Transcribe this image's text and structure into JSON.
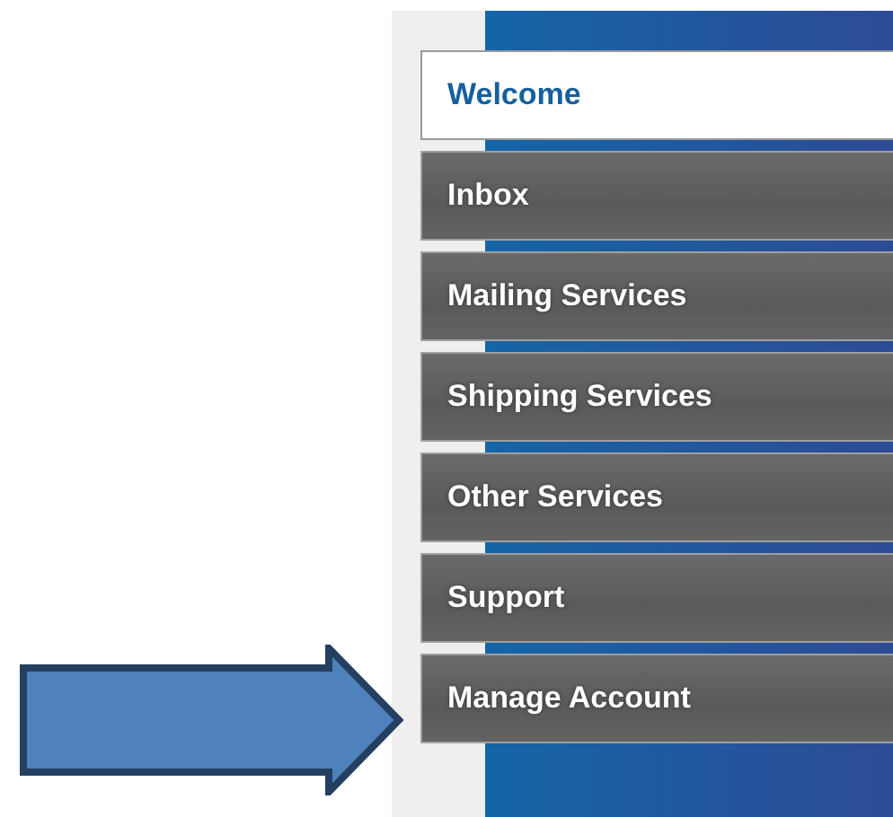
{
  "menu": {
    "items": [
      {
        "label": "Welcome",
        "selected": true
      },
      {
        "label": "Inbox",
        "selected": false
      },
      {
        "label": "Mailing Services",
        "selected": false
      },
      {
        "label": "Shipping Services",
        "selected": false
      },
      {
        "label": "Other Services",
        "selected": false
      },
      {
        "label": "Support",
        "selected": false
      },
      {
        "label": "Manage Account",
        "selected": false
      }
    ]
  }
}
